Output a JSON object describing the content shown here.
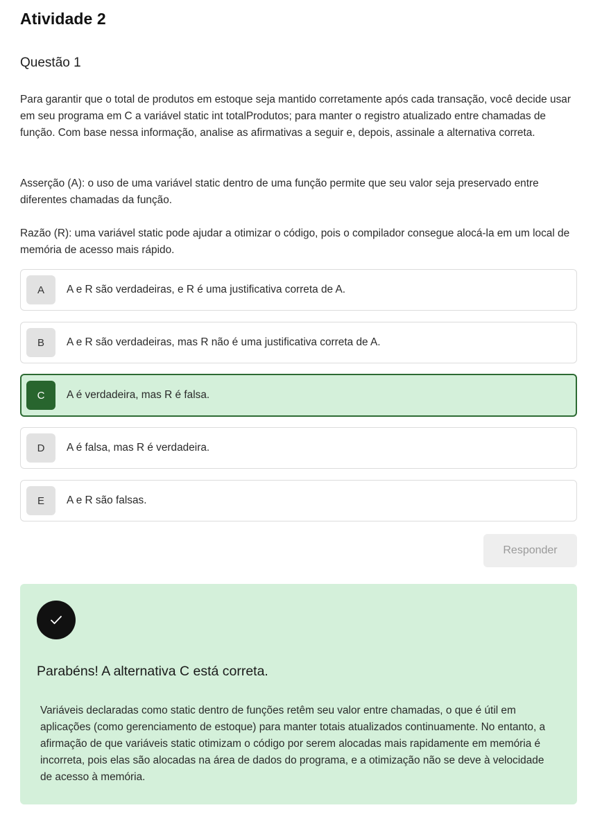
{
  "activity": {
    "title": "Atividade 2"
  },
  "question": {
    "title": "Questão 1",
    "paragraphs": [
      "Para garantir que o total de produtos em estoque seja mantido corretamente após cada transação, você decide usar em seu programa em C a variável static int totalProdutos; para manter o registro atualizado entre chamadas de função. Com base nessa informação, analise as afirmativas a seguir e, depois, assinale a alternativa correta.",
      "Asserção (A): o uso de uma variável static dentro de uma função permite que seu valor seja preservado entre diferentes chamadas da função.",
      "Razão (R): uma variável static pode ajudar a otimizar o código, pois o compilador consegue alocá-la em um local de memória de acesso mais rápido."
    ],
    "options": [
      {
        "letter": "A",
        "text": "A e R são verdadeiras, e R é uma justificativa correta de A."
      },
      {
        "letter": "B",
        "text": "A e R são verdadeiras, mas R não é uma justificativa correta de A."
      },
      {
        "letter": "C",
        "text": "A é verdadeira, mas R é falsa."
      },
      {
        "letter": "D",
        "text": "A é falsa, mas R é verdadeira."
      },
      {
        "letter": "E",
        "text": "A e R são falsas."
      }
    ],
    "selected_option": "C",
    "respond_label": "Responder"
  },
  "feedback": {
    "icon": "check-icon",
    "title": "Parabéns! A alternativa C está correta.",
    "text": "Variáveis declaradas como static dentro de funções retêm seu valor entre chamadas, o que é útil em aplicações (como gerenciamento de estoque) para manter totais atualizados continuamente. No entanto, a afirmação de que variáveis static otimizam o código por serem alocadas mais rapidamente em memória é incorreta, pois elas são alocadas na área de dados do programa, e a otimização não se deve à velocidade de acesso à memória."
  },
  "colors": {
    "selected_border": "#2d6a33",
    "selected_background": "#d4f0da",
    "selected_letter_background": "#28652e",
    "feedback_background": "#d4f0da"
  }
}
